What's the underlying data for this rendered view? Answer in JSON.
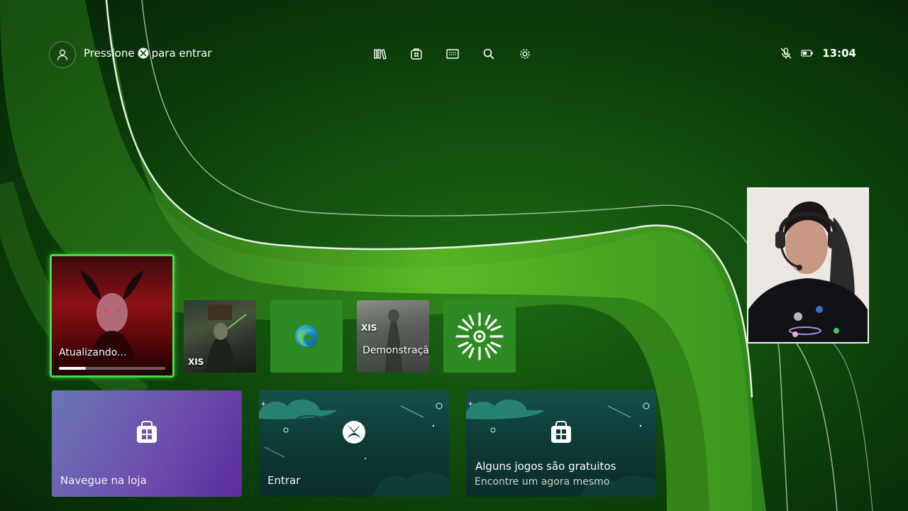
{
  "header": {
    "signin_prefix": "Pressione",
    "signin_suffix": "para entrar",
    "time": "13:04",
    "nav_icons": [
      "library-icon",
      "store-icon",
      "game-pass-icon",
      "search-icon",
      "settings-icon"
    ],
    "status_icons": [
      "mic-muted-icon",
      "battery-icon"
    ]
  },
  "tiles": {
    "main": {
      "label": "Atualizando...",
      "progress": 0.25
    },
    "exile": {
      "badge": "XIS"
    },
    "edge": {
      "icon": "edge-icon"
    },
    "demo": {
      "badge": "XIS",
      "label": "Demonstração"
    },
    "sun": {
      "icon": "sun-app-icon"
    }
  },
  "cards": {
    "store": {
      "label": "Navegue na loja",
      "icon": "store-bag-icon"
    },
    "signin": {
      "label": "Entrar",
      "icon": "xbox-logo-icon"
    },
    "free": {
      "title": "Alguns jogos são gratuitos",
      "subtitle": "Encontre um agora mesmo",
      "icon": "store-bag-icon"
    }
  },
  "colors": {
    "accent_green": "#48d846",
    "tile_green": "#2e8a22",
    "background": "#0a3b08"
  }
}
